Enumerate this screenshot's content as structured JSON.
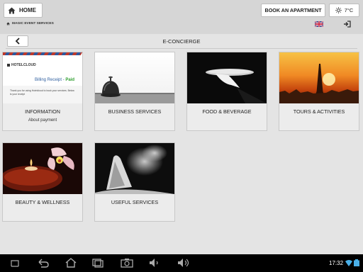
{
  "header": {
    "home_label": "HOME",
    "book_label": "BOOK AN APARTMENT",
    "weather": "7°C",
    "breadcrumb": "MAGIC EVENT SERVICES"
  },
  "page": {
    "title": "E-CONCIERGE"
  },
  "tiles": [
    {
      "label": "INFORMATION",
      "sub": "About payment"
    },
    {
      "label": "BUSINESS SERVICES"
    },
    {
      "label": "FOOD & BEVERAGE"
    },
    {
      "label": "TOURS & ACTIVITIES"
    },
    {
      "label": "BEAUTY & WELLNESS"
    },
    {
      "label": "USEFUL SERVICES"
    }
  ],
  "receipt": {
    "brand": "HOTELCLOUD",
    "title": "Billing Receipt - ",
    "status": "Paid",
    "body": "Thank you for using Hotelcloud to book your services. Below is your receipt"
  },
  "system_bar": {
    "time": "17:32"
  },
  "icons": [
    "home-icon",
    "sun-icon",
    "uk-flag-icon",
    "logout-icon",
    "back-arrow-icon",
    "nav-back-icon",
    "nav-home-icon",
    "nav-recent-icon",
    "camera-icon",
    "volume-down-icon",
    "volume-up-icon",
    "wifi-icon",
    "battery-icon"
  ],
  "colors": {
    "paid": "#2e9e2e",
    "topbar": "#d6d6d6",
    "background": "#e4e4e4"
  }
}
